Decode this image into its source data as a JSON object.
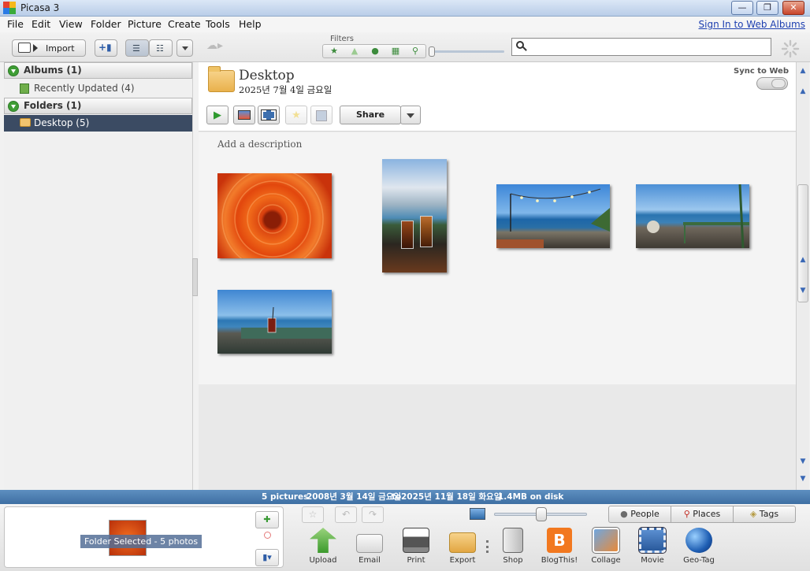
{
  "window": {
    "title": "Picasa 3",
    "minimize": "—",
    "maximize": "❐",
    "close": "✕"
  },
  "menu": {
    "items": [
      "File",
      "Edit",
      "View",
      "Folder",
      "Picture",
      "Create",
      "Tools",
      "Help"
    ],
    "sign_in": "Sign In to Web Albums"
  },
  "toolbar": {
    "import_label": "Import",
    "filters_label": "Filters",
    "filters": [
      "star-icon",
      "upload-arrow-icon",
      "person-icon",
      "film-icon",
      "pin-icon"
    ]
  },
  "left_pane": {
    "albums": {
      "label": "Albums (1)",
      "items": [
        {
          "label": "Recently Updated (4)"
        }
      ]
    },
    "folders": {
      "label": "Folders (1)",
      "items": [
        {
          "label": "Desktop (5)",
          "selected": true
        }
      ]
    }
  },
  "main": {
    "folder_title": "Desktop",
    "folder_date": "2025년 7월 4일 금요일",
    "sync_label": "Sync to Web",
    "share_label": "Share",
    "description_placeholder": "Add a description",
    "photo_count": 5
  },
  "status": {
    "pictures": "5 pictures",
    "range_from": "2008년 3월 14일 금요일",
    "range_to_word": "to",
    "range_to": "2025년 11월 18일 화요일",
    "disk": "1.4MB on disk"
  },
  "tray": {
    "label": "Folder Selected - 5 photos"
  },
  "bottom": {
    "people": "People",
    "places": "Places",
    "tags": "Tags",
    "actions": [
      "Upload",
      "Email",
      "Print",
      "Export",
      "Shop",
      "BlogThis!",
      "Collage",
      "Movie",
      "Geo-Tag"
    ]
  },
  "colors": {
    "accent": "#3b4b63",
    "status_bar": "#4f80b3",
    "green": "#3e9d34"
  }
}
